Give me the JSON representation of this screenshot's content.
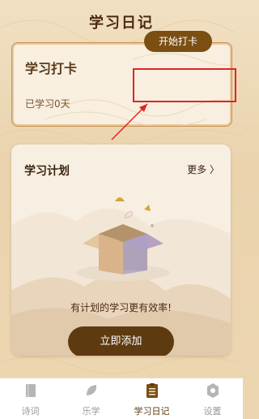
{
  "header": {
    "title": "学习日记"
  },
  "checkin": {
    "title": "学习打卡",
    "days_text": "已学习0天",
    "button_label": "开始打卡"
  },
  "plan": {
    "title": "学习计划",
    "more_label": "更多 〉",
    "hint": "有计划的学习更有效率!",
    "add_label": "立即添加"
  },
  "tabbar": {
    "tabs": [
      {
        "label": "诗词",
        "icon": "book-icon"
      },
      {
        "label": "乐学",
        "icon": "leaf-icon"
      },
      {
        "label": "学习日记",
        "icon": "clipboard-icon"
      },
      {
        "label": "设置",
        "icon": "gear-icon"
      }
    ],
    "active_index": 2
  },
  "colors": {
    "accent": "#7b4e12",
    "highlight": "#e02525",
    "active_tab": "#5e3a10",
    "inactive_tab": "#9a9a9a"
  }
}
